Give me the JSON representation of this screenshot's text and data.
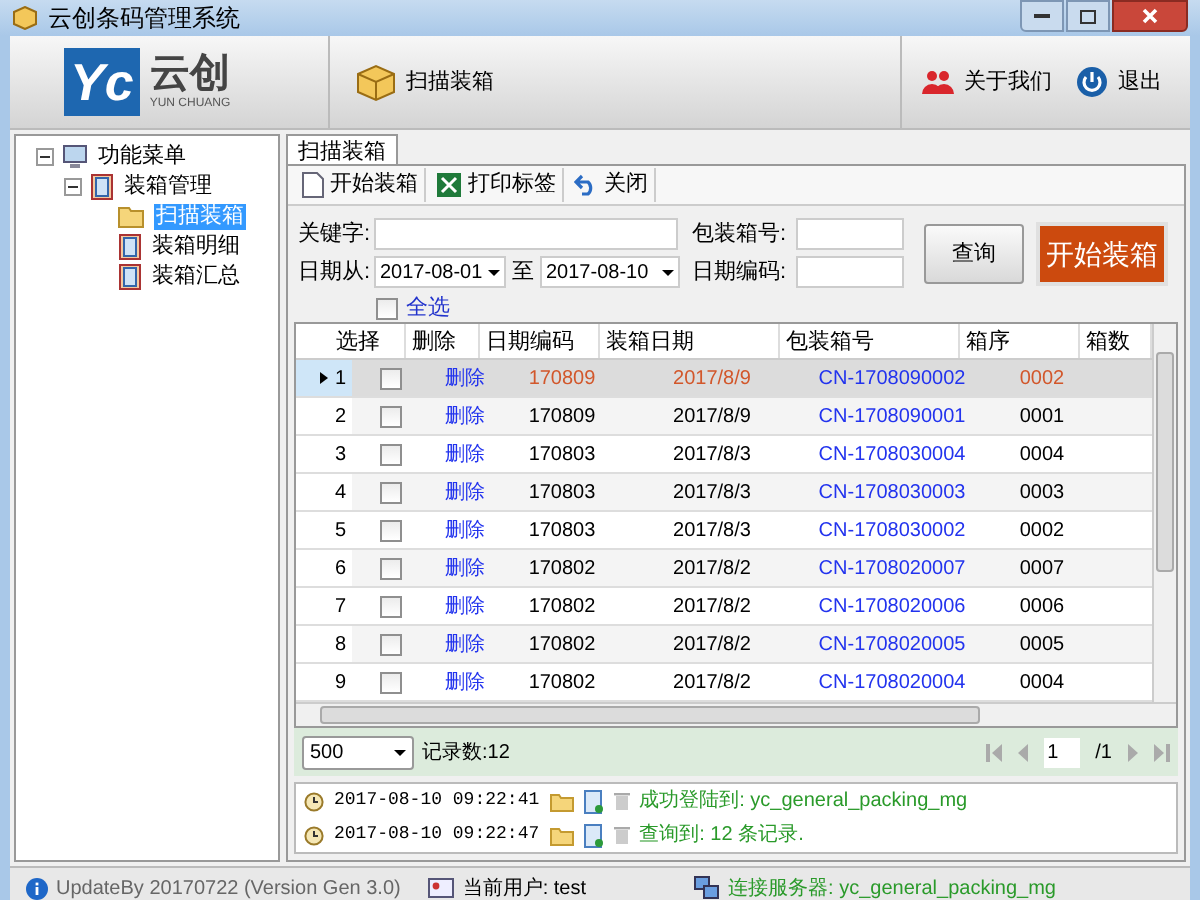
{
  "window": {
    "title": "云创条码管理系统"
  },
  "header": {
    "logo_mark": "Yc",
    "logo_name": "云创",
    "logo_sub": "YUN CHUANG",
    "tools": [
      {
        "label": "扫描装箱"
      }
    ],
    "actions": [
      {
        "kind": "people",
        "label": "关于我们"
      },
      {
        "kind": "power",
        "label": "退出"
      }
    ]
  },
  "sidebar": {
    "tree": [
      {
        "label": "功能菜单",
        "kind": "root",
        "expanded": true,
        "selected": false,
        "children": [
          {
            "label": "装箱管理",
            "kind": "book",
            "expanded": true,
            "selected": false,
            "children": [
              {
                "label": "扫描装箱",
                "kind": "folder",
                "selected": true
              },
              {
                "label": "装箱明细",
                "kind": "book",
                "selected": false
              },
              {
                "label": "装箱汇总",
                "kind": "book",
                "selected": false
              }
            ]
          }
        ]
      }
    ]
  },
  "tabs": [
    {
      "label": "扫描装箱",
      "selected": true
    }
  ],
  "toolbar": [
    {
      "kind": "new",
      "label": "开始装箱"
    },
    {
      "kind": "excel",
      "label": "打印标签"
    },
    {
      "kind": "undo",
      "label": "关闭"
    }
  ],
  "form": {
    "keyword_label": "关键字:",
    "box_no_label": "包装箱号:",
    "date_from_label": "日期从:",
    "date_from": "2017-08-01",
    "date_to_label": "至",
    "date_to": "2017-08-10",
    "date_code_label": "日期编码:",
    "select_all": {
      "label": "全选",
      "checked": false
    },
    "query_button": "查询",
    "start_button": "开始装箱"
  },
  "table": {
    "columns": [
      "选择",
      "删除",
      "日期编码",
      "装箱日期",
      "包装箱号",
      "箱序",
      "箱数"
    ],
    "rows": [
      {
        "num": "1",
        "checked": false,
        "delete": "删除",
        "date_code": "170809",
        "pack_date": "2017/8/9",
        "box_no": "CN-1708090002",
        "seq": "0002",
        "selected": true
      },
      {
        "num": "2",
        "checked": false,
        "delete": "删除",
        "date_code": "170809",
        "pack_date": "2017/8/9",
        "box_no": "CN-1708090001",
        "seq": "0001",
        "selected": false
      },
      {
        "num": "3",
        "checked": false,
        "delete": "删除",
        "date_code": "170803",
        "pack_date": "2017/8/3",
        "box_no": "CN-1708030004",
        "seq": "0004",
        "selected": false
      },
      {
        "num": "4",
        "checked": false,
        "delete": "删除",
        "date_code": "170803",
        "pack_date": "2017/8/3",
        "box_no": "CN-1708030003",
        "seq": "0003",
        "selected": false
      },
      {
        "num": "5",
        "checked": false,
        "delete": "删除",
        "date_code": "170803",
        "pack_date": "2017/8/3",
        "box_no": "CN-1708030002",
        "seq": "0002",
        "selected": false
      },
      {
        "num": "6",
        "checked": false,
        "delete": "删除",
        "date_code": "170802",
        "pack_date": "2017/8/2",
        "box_no": "CN-1708020007",
        "seq": "0007",
        "selected": false
      },
      {
        "num": "7",
        "checked": false,
        "delete": "删除",
        "date_code": "170802",
        "pack_date": "2017/8/2",
        "box_no": "CN-1708020006",
        "seq": "0006",
        "selected": false
      },
      {
        "num": "8",
        "checked": false,
        "delete": "删除",
        "date_code": "170802",
        "pack_date": "2017/8/2",
        "box_no": "CN-1708020005",
        "seq": "0005",
        "selected": false
      },
      {
        "num": "9",
        "checked": false,
        "delete": "删除",
        "date_code": "170802",
        "pack_date": "2017/8/2",
        "box_no": "CN-1708020004",
        "seq": "0004",
        "selected": false
      }
    ]
  },
  "pager": {
    "page_size": "500",
    "record_count": "记录数:12",
    "page": "1",
    "total": "/1"
  },
  "log": [
    {
      "time": "2017-08-10 09:22:41",
      "message": "成功登陆到: yc_general_packing_mg"
    },
    {
      "time": "2017-08-10 09:22:47",
      "message": "查询到: 12 条记录."
    }
  ],
  "status_bar": {
    "version": "UpdateBy 20170722 (Version Gen 3.0)",
    "user": "当前用户: test",
    "server": "连接服务器: yc_general_packing_mg"
  }
}
